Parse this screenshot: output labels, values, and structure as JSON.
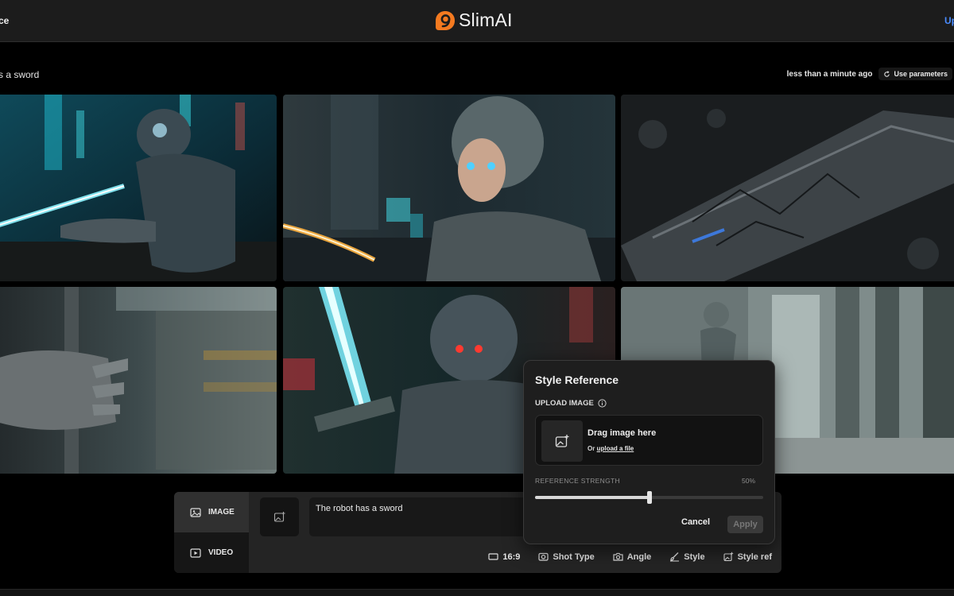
{
  "header": {
    "left_label": "ce",
    "brand_name": "SlimAI",
    "right_label": "Up"
  },
  "generation": {
    "prompt_fragment": "s a sword",
    "time": "less than a minute ago",
    "use_parameters_label": "Use parameters"
  },
  "gallery": {
    "images": [
      {
        "subject": "robot firing electric beam"
      },
      {
        "subject": "android woman with glowing sword"
      },
      {
        "subject": "close-up of cracked metal blade"
      },
      {
        "subject": "robot hand gripping sword"
      },
      {
        "subject": "robot with glowing cyan sword"
      },
      {
        "subject": "robot in concrete corridor"
      }
    ]
  },
  "composer": {
    "modes": [
      {
        "label": "IMAGE",
        "icon": "image-icon",
        "active": true
      },
      {
        "label": "VIDEO",
        "icon": "video-icon",
        "active": false
      }
    ],
    "prompt_text": "The robot has a sword",
    "options": [
      {
        "label": "16:9",
        "icon": "aspect-ratio-icon"
      },
      {
        "label": "Shot Type",
        "icon": "camera-icon"
      },
      {
        "label": "Angle",
        "icon": "angle-camera-icon"
      },
      {
        "label": "Style",
        "icon": "brush-icon"
      },
      {
        "label": "Style ref",
        "icon": "image-add-icon"
      }
    ]
  },
  "style_reference": {
    "title": "Style Reference",
    "upload_label": "UPLOAD IMAGE",
    "drag_text": "Drag image here",
    "or_text": "Or",
    "upload_link": "upload a file",
    "strength_label": "REFERENCE STRENGTH",
    "strength_value": "50%",
    "strength_fraction": 0.5,
    "cancel_label": "Cancel",
    "apply_label": "Apply"
  },
  "colors": {
    "brand_orange": "#f47a20",
    "link_blue": "#4a8cff",
    "panel_bg": "#1e1e1e"
  }
}
